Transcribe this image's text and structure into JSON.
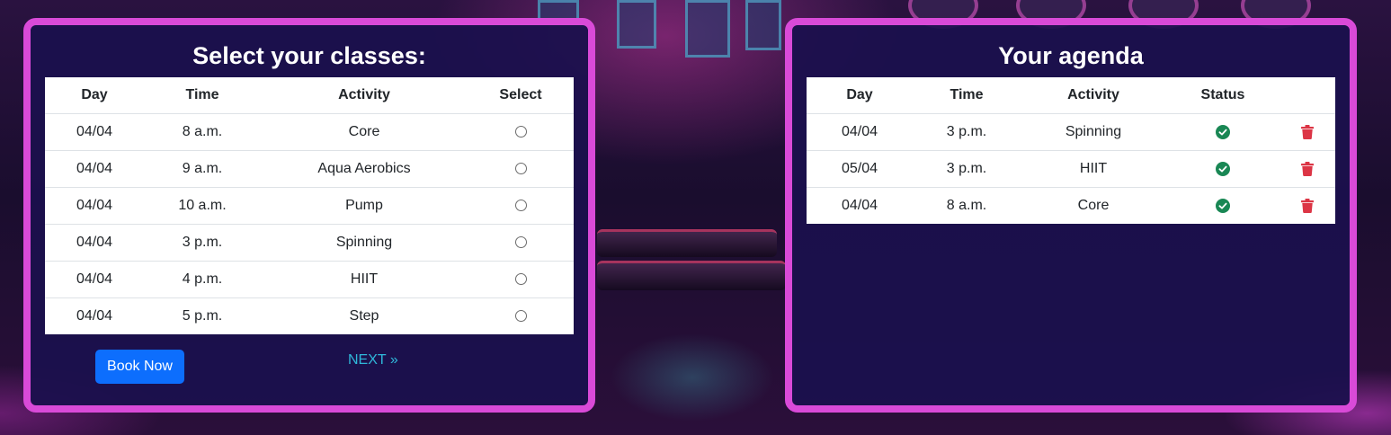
{
  "classes_panel": {
    "title": "Select your classes:",
    "columns": [
      "Day",
      "Time",
      "Activity",
      "Select"
    ],
    "rows": [
      {
        "day": "04/04",
        "time": "8 a.m.",
        "activity": "Core"
      },
      {
        "day": "04/04",
        "time": "9 a.m.",
        "activity": "Aqua Aerobics"
      },
      {
        "day": "04/04",
        "time": "10 a.m.",
        "activity": "Pump"
      },
      {
        "day": "04/04",
        "time": "3 p.m.",
        "activity": "Spinning"
      },
      {
        "day": "04/04",
        "time": "4 p.m.",
        "activity": "HIIT"
      },
      {
        "day": "04/04",
        "time": "5 p.m.",
        "activity": "Step"
      }
    ],
    "book_button": "Book Now",
    "next_link": "NEXT »"
  },
  "agenda_panel": {
    "title": "Your agenda",
    "columns": [
      "Day",
      "Time",
      "Activity",
      "Status"
    ],
    "rows": [
      {
        "day": "04/04",
        "time": "3 p.m.",
        "activity": "Spinning",
        "status_icon": "check-circle-icon",
        "action_icon": "trash-icon"
      },
      {
        "day": "05/04",
        "time": "3 p.m.",
        "activity": "HIIT",
        "status_icon": "check-circle-icon",
        "action_icon": "trash-icon"
      },
      {
        "day": "04/04",
        "time": "8 a.m.",
        "activity": "Core",
        "status_icon": "check-circle-icon",
        "action_icon": "trash-icon"
      }
    ]
  },
  "colors": {
    "panel_border": "#d94ad8",
    "panel_background": "#1b104e",
    "book_button": "#0d6efd",
    "next_link": "#2fb7d9",
    "status_ok": "#198754",
    "delete": "#dc3545"
  }
}
